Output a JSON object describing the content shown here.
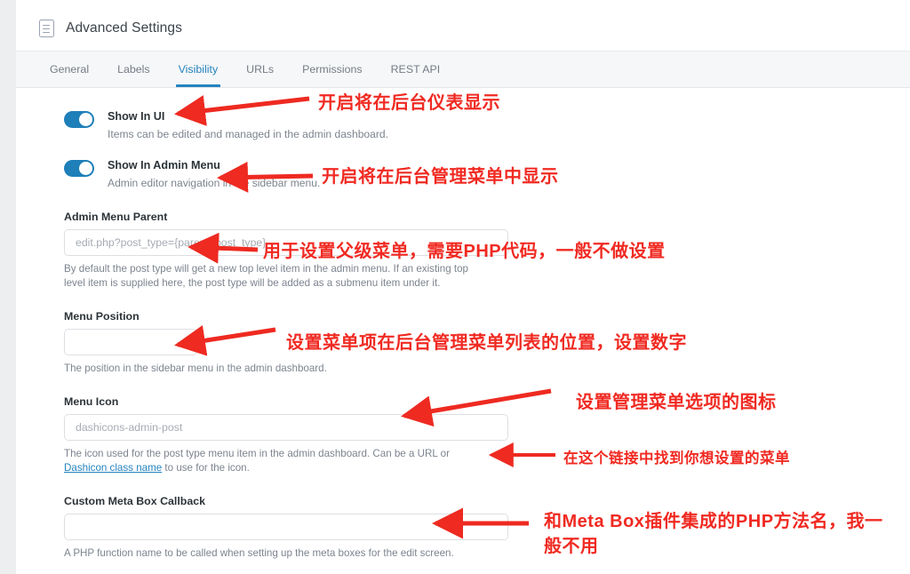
{
  "header": {
    "title": "Advanced Settings",
    "icon": "document-icon"
  },
  "tabs": [
    {
      "label": "General",
      "active": false
    },
    {
      "label": "Labels",
      "active": false
    },
    {
      "label": "Visibility",
      "active": true
    },
    {
      "label": "URLs",
      "active": false
    },
    {
      "label": "Permissions",
      "active": false
    },
    {
      "label": "REST API",
      "active": false
    }
  ],
  "toggles": [
    {
      "label": "Show In UI",
      "description": "Items can be edited and managed in the admin dashboard.",
      "state": "on"
    },
    {
      "label": "Show In Admin Menu",
      "description": "Admin editor navigation in the sidebar menu.",
      "state": "on"
    }
  ],
  "fields": {
    "admin_menu_parent": {
      "label": "Admin Menu Parent",
      "value": "",
      "placeholder": "edit.php?post_type={parent_post_type}",
      "help": "By default the post type will get a new top level item in the admin menu. If an existing top level item is supplied here, the post type will be added as a submenu item under it."
    },
    "menu_position": {
      "label": "Menu Position",
      "value": "",
      "placeholder": "",
      "help": "The position in the sidebar menu in the admin dashboard."
    },
    "menu_icon": {
      "label": "Menu Icon",
      "value": "",
      "placeholder": "dashicons-admin-post",
      "help_before": "The icon used for the post type menu item in the admin dashboard. Can be a URL or ",
      "help_link": "Dashicon class name",
      "help_after": " to use for the icon."
    },
    "custom_meta_box_callback": {
      "label": "Custom Meta Box Callback",
      "value": "",
      "placeholder": "",
      "help": "A PHP function name to be called when setting up the meta boxes for the edit screen."
    }
  },
  "annotations": [
    {
      "id": "anno-show-in-ui",
      "text": "开启将在后台仪表显示"
    },
    {
      "id": "anno-show-in-admin",
      "text": "开启将在后台管理菜单中显示"
    },
    {
      "id": "anno-admin-parent",
      "text": "用于设置父级菜单，需要PHP代码，一般不做设置"
    },
    {
      "id": "anno-menu-position",
      "text": "设置菜单项在后台管理菜单列表的位置，设置数字"
    },
    {
      "id": "anno-menu-icon",
      "text": "设置管理菜单选项的图标"
    },
    {
      "id": "anno-dashicon-link",
      "text": "在这个链接中找到你想设置的菜单"
    },
    {
      "id": "anno-meta-box",
      "text": "和Meta Box插件集成的PHP方法名，我一般不用"
    }
  ],
  "colors": {
    "accent": "#2484bf",
    "toggle_on": "#1e7fb9",
    "annotation": "#f02a22",
    "panel_bg": "#ffffff",
    "tabbar_bg": "#f6f7f8",
    "page_bg": "#eceef0"
  }
}
